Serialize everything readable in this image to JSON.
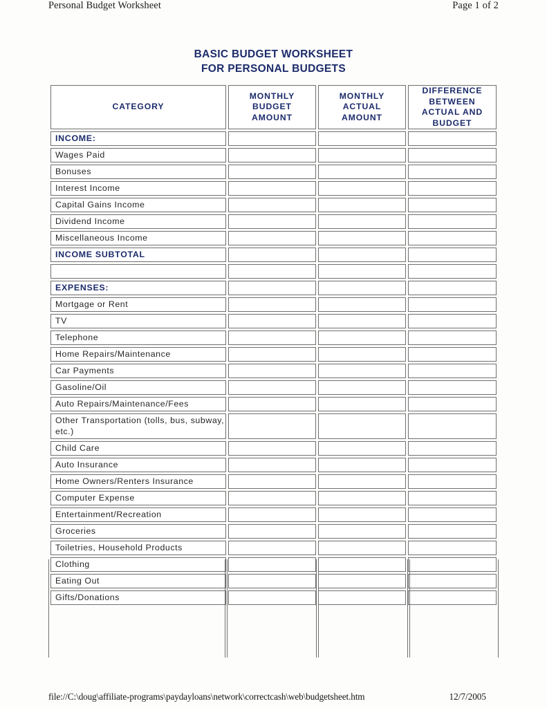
{
  "print_header": {
    "left": "Personal Budget Worksheet",
    "right": "Page 1 of 2"
  },
  "title": {
    "line1": "BASIC BUDGET WORKSHEET",
    "line2": "FOR PERSONAL BUDGETS",
    "color": "#1c2b6b"
  },
  "table": {
    "columns": [
      {
        "key": "category",
        "label": "CATEGORY"
      },
      {
        "key": "budget",
        "label": "MONTHLY\nBUDGET\nAMOUNT",
        "lines": [
          "MONTHLY",
          "BUDGET",
          "AMOUNT"
        ]
      },
      {
        "key": "actual",
        "label": "MONTHLY\nACTUAL\nAMOUNT",
        "lines": [
          "MONTHLY",
          "ACTUAL",
          "AMOUNT"
        ]
      },
      {
        "key": "difference",
        "label": "DIFFERENCE\nBETWEEN\nACTUAL AND\nBUDGET",
        "lines": [
          "DIFFERENCE",
          "BETWEEN",
          "ACTUAL AND",
          "BUDGET"
        ]
      }
    ],
    "rows": [
      {
        "category": "INCOME:",
        "type": "section",
        "budget": "",
        "actual": "",
        "difference": ""
      },
      {
        "category": "Wages Paid",
        "type": "item",
        "budget": "",
        "actual": "",
        "difference": ""
      },
      {
        "category": "Bonuses",
        "type": "item",
        "budget": "",
        "actual": "",
        "difference": ""
      },
      {
        "category": "Interest Income",
        "type": "item",
        "budget": "",
        "actual": "",
        "difference": ""
      },
      {
        "category": "Capital Gains Income",
        "type": "item",
        "budget": "",
        "actual": "",
        "difference": ""
      },
      {
        "category": "Dividend Income",
        "type": "item",
        "budget": "",
        "actual": "",
        "difference": ""
      },
      {
        "category": "Miscellaneous Income",
        "type": "item",
        "budget": "",
        "actual": "",
        "difference": ""
      },
      {
        "category": "INCOME SUBTOTAL",
        "type": "section",
        "budget": "",
        "actual": "",
        "difference": ""
      },
      {
        "category": "",
        "type": "spacer",
        "budget": "",
        "actual": "",
        "difference": ""
      },
      {
        "category": "EXPENSES:",
        "type": "section",
        "budget": "",
        "actual": "",
        "difference": ""
      },
      {
        "category": "Mortgage or Rent",
        "type": "item",
        "budget": "",
        "actual": "",
        "difference": ""
      },
      {
        "category": "TV",
        "type": "item",
        "budget": "",
        "actual": "",
        "difference": ""
      },
      {
        "category": "Telephone",
        "type": "item",
        "budget": "",
        "actual": "",
        "difference": ""
      },
      {
        "category": "Home Repairs/Maintenance",
        "type": "item",
        "budget": "",
        "actual": "",
        "difference": ""
      },
      {
        "category": "Car Payments",
        "type": "item",
        "budget": "",
        "actual": "",
        "difference": ""
      },
      {
        "category": "Gasoline/Oil",
        "type": "item",
        "budget": "",
        "actual": "",
        "difference": ""
      },
      {
        "category": "Auto Repairs/Maintenance/Fees",
        "type": "item",
        "budget": "",
        "actual": "",
        "difference": ""
      },
      {
        "category": "Other Transportation (tolls, bus, subway, etc.)",
        "type": "item-tall",
        "budget": "",
        "actual": "",
        "difference": ""
      },
      {
        "category": "Child Care",
        "type": "item",
        "budget": "",
        "actual": "",
        "difference": ""
      },
      {
        "category": "Auto Insurance",
        "type": "item",
        "budget": "",
        "actual": "",
        "difference": ""
      },
      {
        "category": "Home Owners/Renters Insurance",
        "type": "item",
        "budget": "",
        "actual": "",
        "difference": ""
      },
      {
        "category": "Computer Expense",
        "type": "item",
        "budget": "",
        "actual": "",
        "difference": ""
      },
      {
        "category": "Entertainment/Recreation",
        "type": "item",
        "budget": "",
        "actual": "",
        "difference": ""
      },
      {
        "category": "Groceries",
        "type": "item",
        "budget": "",
        "actual": "",
        "difference": ""
      },
      {
        "category": "Toiletries, Household Products",
        "type": "item",
        "budget": "",
        "actual": "",
        "difference": ""
      },
      {
        "category": "Clothing",
        "type": "item",
        "budget": "",
        "actual": "",
        "difference": ""
      },
      {
        "category": "Eating Out",
        "type": "item",
        "budget": "",
        "actual": "",
        "difference": ""
      },
      {
        "category": "Gifts/Donations",
        "type": "item",
        "budget": "",
        "actual": "",
        "difference": ""
      }
    ]
  },
  "print_footer": {
    "url": "file://C:\\doug\\affiliate-programs\\paydayloans\\network\\correctcash\\web\\budgetsheet.htm",
    "date": "12/7/2005"
  }
}
